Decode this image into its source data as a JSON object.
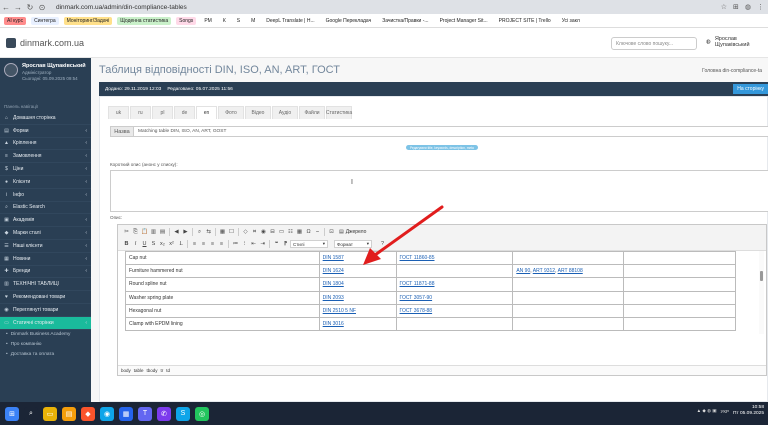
{
  "browser": {
    "url": "dinmark.com.ua/admin/din-compliance-tables",
    "bookmarks": [
      "AI курс",
      "Синтегра",
      "Моніторинг/Задачі",
      "Щоденна статистика",
      "Songs",
      "PM",
      "К",
      "S",
      "М",
      "DeepL Translate | Н...",
      "Google Перекладач",
      "Зачистка/Правки -...",
      "Project Manager Sit...",
      "PROJECT SITE | Trello",
      "Усі закл"
    ]
  },
  "header": {
    "logo_text": "dinmark.com.ua",
    "search_placeholder": "Ключове слово пошуку...",
    "user_name": "Ярослав Щупаківський"
  },
  "sidebar": {
    "profile": {
      "name": "Ярослав Щупаківський",
      "role": "Адміністратор",
      "date": "Сьогодні: 05.09.2025 09:54"
    },
    "section_title": "Панель навігації",
    "items": [
      {
        "icon": "home-icon",
        "glyph": "⌂",
        "label": "Домашня сторінка",
        "chevron": false,
        "active": false
      },
      {
        "icon": "forms-icon",
        "glyph": "▤",
        "label": "Форми",
        "chevron": true,
        "active": false
      },
      {
        "icon": "cart-icon",
        "glyph": "▲",
        "label": "Кріплення",
        "chevron": true,
        "active": false
      },
      {
        "icon": "orders-icon",
        "glyph": "≡",
        "label": "Замовлення",
        "chevron": true,
        "active": false
      },
      {
        "icon": "prices-icon",
        "glyph": "$",
        "label": "Ціни",
        "chevron": true,
        "active": false
      },
      {
        "icon": "clients-icon",
        "glyph": "●",
        "label": "Клієнти",
        "chevron": true,
        "active": false
      },
      {
        "icon": "info-icon",
        "glyph": "i",
        "label": "Інфо",
        "chevron": true,
        "active": false
      },
      {
        "icon": "search-icon",
        "glyph": "⌕",
        "label": "Elastic Search",
        "chevron": false,
        "active": false
      },
      {
        "icon": "academy-icon",
        "glyph": "▣",
        "label": "Академія",
        "chevron": true,
        "active": false
      },
      {
        "icon": "steel-icon",
        "glyph": "◆",
        "label": "Марки сталі",
        "chevron": true,
        "active": false
      },
      {
        "icon": "clients-icon",
        "glyph": "☰",
        "label": "Наші клієнти",
        "chevron": true,
        "active": false
      },
      {
        "icon": "news-icon",
        "glyph": "▦",
        "label": "Новини",
        "chevron": true,
        "active": false
      },
      {
        "icon": "brands-icon",
        "glyph": "✚",
        "label": "Бренди",
        "chevron": true,
        "active": false
      },
      {
        "icon": "tables-icon",
        "glyph": "▥",
        "label": "ТЕХНІЧНІ ТАБЛИЦІ",
        "chevron": false,
        "active": false
      },
      {
        "icon": "heart-icon",
        "glyph": "♥",
        "label": "Рекомендовані товари",
        "chevron": false,
        "active": false
      },
      {
        "icon": "eye-icon",
        "glyph": "◉",
        "label": "Переглянуті товари",
        "chevron": false,
        "active": false
      },
      {
        "icon": "pages-icon",
        "glyph": "▭",
        "label": "Статичні сторінки",
        "chevron": true,
        "active": true
      }
    ],
    "subitems": [
      "Dinmark Business Academy",
      "Про компанію",
      "Доставка та оплата"
    ]
  },
  "main": {
    "title": "Таблиця відповідності DIN, ISO, AN, ART, ГОСТ",
    "breadcrumbs": "Головна    din-compliance-ta",
    "info_bar": {
      "added": "Додано: 29.11.2019 12:03",
      "edited": "Редаговано: 05.07.2025 11:56",
      "button": "На сторінку"
    },
    "tabs": [
      "uk",
      "ru",
      "pl",
      "de",
      "en",
      "Фото",
      "Відео",
      "Аудіо",
      "Файли",
      "Статистика"
    ],
    "active_tab": "en",
    "name_label": "Назва",
    "name_value": "Matching table DIN, ISO, AN, ART, GOST",
    "meta_button": "Редагувати title, keywords, description, meta",
    "short_label": "Короткий опис (анонс у списку):",
    "desc_label": "Опис:",
    "toolbar": {
      "row1": [
        "✂",
        "⎘",
        "📋",
        "▥",
        "▤",
        "◀",
        "▶",
        "⌕",
        "⇆",
        "▦",
        "☐",
        "◇",
        "⌗",
        "◉",
        "⊟",
        "▭",
        "☷",
        "▦",
        "Ω",
        "⎯",
        "⊡"
      ],
      "source_label": "Джерело",
      "row2": [
        "B",
        "I",
        "U",
        "S",
        "x₂",
        "x²",
        "I̶",
        "≡",
        "≡",
        "≡",
        "≡",
        "≔",
        "⁝",
        "⇤",
        "⇥",
        "❝",
        "⁋"
      ],
      "style_combo": "Стилі",
      "format_combo": "Формат",
      "help": "?"
    },
    "table_rows": [
      [
        "Cap nut",
        "DIN 1587",
        "ГОСТ 11860-85",
        "",
        ""
      ],
      [
        "Furniture hammered nut",
        "DIN 1624",
        "",
        "AN 90, ART 9312, ART 88108",
        ""
      ],
      [
        "Round spline nut",
        "DIN 1804",
        "ГОСТ 11871-88",
        "",
        ""
      ],
      [
        "Washer spring plate",
        "DIN 2093",
        "ГОСТ 3057-90",
        "",
        ""
      ],
      [
        "Hexagonal nut",
        "DIN 2510 5 NF",
        "ГОСТ 3678-88",
        "",
        ""
      ],
      [
        "Clamp with EPDM lining",
        "DIN 3016",
        "",
        "",
        ""
      ]
    ],
    "path_bar": [
      "body",
      "table",
      "tbody",
      "tr",
      "td"
    ]
  },
  "taskbar": {
    "apps": [
      "start",
      "search",
      "files",
      "explorer",
      "brave",
      "edge",
      "store",
      "teams",
      "viber",
      "skype",
      "chrome"
    ],
    "lang": "УКР",
    "time": "10:58",
    "date": "Пт 05.09.2025"
  },
  "colors": {
    "sidebar": "#2a3f54",
    "active": "#1abb9c",
    "link": "#1a5fb4",
    "arrow": "#e11d1d",
    "info_button": "#3498db"
  }
}
